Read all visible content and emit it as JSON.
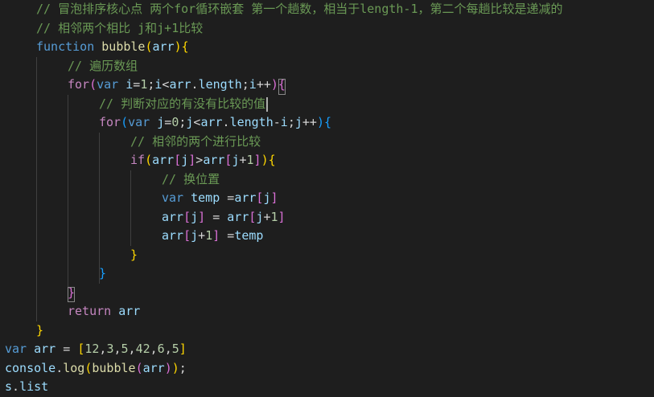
{
  "editor": {
    "theme": "Dark+ (VS Code)",
    "colors": {
      "background": "#1e1e1e",
      "comment": "#6a9955",
      "keyword": "#569cd6",
      "control": "#c586c0",
      "function": "#dcdcaa",
      "variable": "#9cdcfe",
      "number": "#b5cea8",
      "plain": "#d4d4d4",
      "bracket_level1": "#ffd700",
      "bracket_level2": "#da70d6",
      "bracket_level3": "#179fff"
    },
    "lines": [
      {
        "indent": 1,
        "tokens": [
          [
            "comment",
            "// 冒泡排序核心点 两个for循环嵌套 第一个趟数，相当于length-1，第二个每趟比较是递减的"
          ]
        ]
      },
      {
        "indent": 1,
        "tokens": [
          [
            "comment",
            "// 相邻两个相比 j和j+1比较"
          ]
        ]
      },
      {
        "indent": 1,
        "tokens": [
          [
            "keyword",
            "function"
          ],
          [
            "plain",
            " "
          ],
          [
            "func",
            "bubble"
          ],
          [
            "b1",
            "("
          ],
          [
            "var",
            "arr"
          ],
          [
            "b1",
            ")"
          ],
          [
            "b1",
            "{"
          ]
        ]
      },
      {
        "indent": 2,
        "tokens": [
          [
            "comment",
            "// 遍历数组"
          ]
        ]
      },
      {
        "indent": 2,
        "tokens": [
          [
            "control",
            "for"
          ],
          [
            "b2",
            "("
          ],
          [
            "keyword",
            "var"
          ],
          [
            "plain",
            " "
          ],
          [
            "var",
            "i"
          ],
          [
            "plain",
            "="
          ],
          [
            "num",
            "1"
          ],
          [
            "plain",
            ";"
          ],
          [
            "var",
            "i"
          ],
          [
            "plain",
            "<"
          ],
          [
            "var",
            "arr"
          ],
          [
            "plain",
            "."
          ],
          [
            "var",
            "length"
          ],
          [
            "plain",
            ";"
          ],
          [
            "var",
            "i"
          ],
          [
            "plain",
            "++"
          ],
          [
            "b2",
            ")"
          ],
          [
            "b2",
            "{"
          ]
        ]
      },
      {
        "indent": 3,
        "tokens": [
          [
            "comment",
            "// 判断对应的有没有比较的值"
          ]
        ]
      },
      {
        "indent": 3,
        "tokens": [
          [
            "control",
            "for"
          ],
          [
            "b3",
            "("
          ],
          [
            "keyword",
            "var"
          ],
          [
            "plain",
            " "
          ],
          [
            "var",
            "j"
          ],
          [
            "plain",
            "="
          ],
          [
            "num",
            "0"
          ],
          [
            "plain",
            ";"
          ],
          [
            "var",
            "j"
          ],
          [
            "plain",
            "<"
          ],
          [
            "var",
            "arr"
          ],
          [
            "plain",
            "."
          ],
          [
            "var",
            "length"
          ],
          [
            "plain",
            "-"
          ],
          [
            "var",
            "i"
          ],
          [
            "plain",
            ";"
          ],
          [
            "var",
            "j"
          ],
          [
            "plain",
            "++"
          ],
          [
            "b3",
            ")"
          ],
          [
            "b3",
            "{"
          ]
        ]
      },
      {
        "indent": 4,
        "tokens": [
          [
            "comment",
            "// 相邻的两个进行比较"
          ]
        ]
      },
      {
        "indent": 4,
        "tokens": [
          [
            "control",
            "if"
          ],
          [
            "b1",
            "("
          ],
          [
            "var",
            "arr"
          ],
          [
            "b2",
            "["
          ],
          [
            "var",
            "j"
          ],
          [
            "b2",
            "]"
          ],
          [
            "plain",
            ">"
          ],
          [
            "var",
            "arr"
          ],
          [
            "b2",
            "["
          ],
          [
            "var",
            "j"
          ],
          [
            "plain",
            "+"
          ],
          [
            "num",
            "1"
          ],
          [
            "b2",
            "]"
          ],
          [
            "b1",
            ")"
          ],
          [
            "b1",
            "{"
          ]
        ]
      },
      {
        "indent": 5,
        "tokens": [
          [
            "comment",
            "// 换位置"
          ]
        ]
      },
      {
        "indent": 5,
        "tokens": [
          [
            "keyword",
            "var"
          ],
          [
            "plain",
            " "
          ],
          [
            "var",
            "temp"
          ],
          [
            "plain",
            " ="
          ],
          [
            "var",
            "arr"
          ],
          [
            "b2",
            "["
          ],
          [
            "var",
            "j"
          ],
          [
            "b2",
            "]"
          ]
        ]
      },
      {
        "indent": 5,
        "tokens": [
          [
            "var",
            "arr"
          ],
          [
            "b2",
            "["
          ],
          [
            "var",
            "j"
          ],
          [
            "b2",
            "]"
          ],
          [
            "plain",
            " = "
          ],
          [
            "var",
            "arr"
          ],
          [
            "b2",
            "["
          ],
          [
            "var",
            "j"
          ],
          [
            "plain",
            "+"
          ],
          [
            "num",
            "1"
          ],
          [
            "b2",
            "]"
          ]
        ]
      },
      {
        "indent": 5,
        "tokens": [
          [
            "var",
            "arr"
          ],
          [
            "b2",
            "["
          ],
          [
            "var",
            "j"
          ],
          [
            "plain",
            "+"
          ],
          [
            "num",
            "1"
          ],
          [
            "b2",
            "]"
          ],
          [
            "plain",
            " ="
          ],
          [
            "var",
            "temp"
          ]
        ]
      },
      {
        "indent": 4,
        "tokens": [
          [
            "b1",
            "}"
          ]
        ]
      },
      {
        "indent": 3,
        "tokens": [
          [
            "b3",
            "}"
          ]
        ]
      },
      {
        "indent": 2,
        "tokens": [
          [
            "b2",
            "}"
          ]
        ]
      },
      {
        "indent": 2,
        "tokens": [
          [
            "control",
            "return"
          ],
          [
            "plain",
            " "
          ],
          [
            "var",
            "arr"
          ]
        ]
      },
      {
        "indent": 1,
        "tokens": [
          [
            "b1",
            "}"
          ]
        ]
      },
      {
        "indent": 0,
        "tokens": [
          [
            "keyword",
            "var"
          ],
          [
            "plain",
            " "
          ],
          [
            "var",
            "arr"
          ],
          [
            "plain",
            " = "
          ],
          [
            "b1",
            "["
          ],
          [
            "num",
            "12"
          ],
          [
            "plain",
            ","
          ],
          [
            "num",
            "3"
          ],
          [
            "plain",
            ","
          ],
          [
            "num",
            "5"
          ],
          [
            "plain",
            ","
          ],
          [
            "num",
            "42"
          ],
          [
            "plain",
            ","
          ],
          [
            "num",
            "6"
          ],
          [
            "plain",
            ","
          ],
          [
            "num",
            "5"
          ],
          [
            "b1",
            "]"
          ]
        ]
      },
      {
        "indent": 0,
        "tokens": [
          [
            "var",
            "console"
          ],
          [
            "plain",
            "."
          ],
          [
            "func",
            "log"
          ],
          [
            "b1",
            "("
          ],
          [
            "func",
            "bubble"
          ],
          [
            "b2",
            "("
          ],
          [
            "var",
            "arr"
          ],
          [
            "b2",
            ")"
          ],
          [
            "b1",
            ")"
          ],
          [
            "plain",
            ";"
          ]
        ]
      },
      {
        "indent": 0,
        "tokens": [
          [
            "var",
            "s"
          ],
          [
            "plain",
            "."
          ],
          [
            "var",
            "list"
          ]
        ]
      }
    ]
  }
}
